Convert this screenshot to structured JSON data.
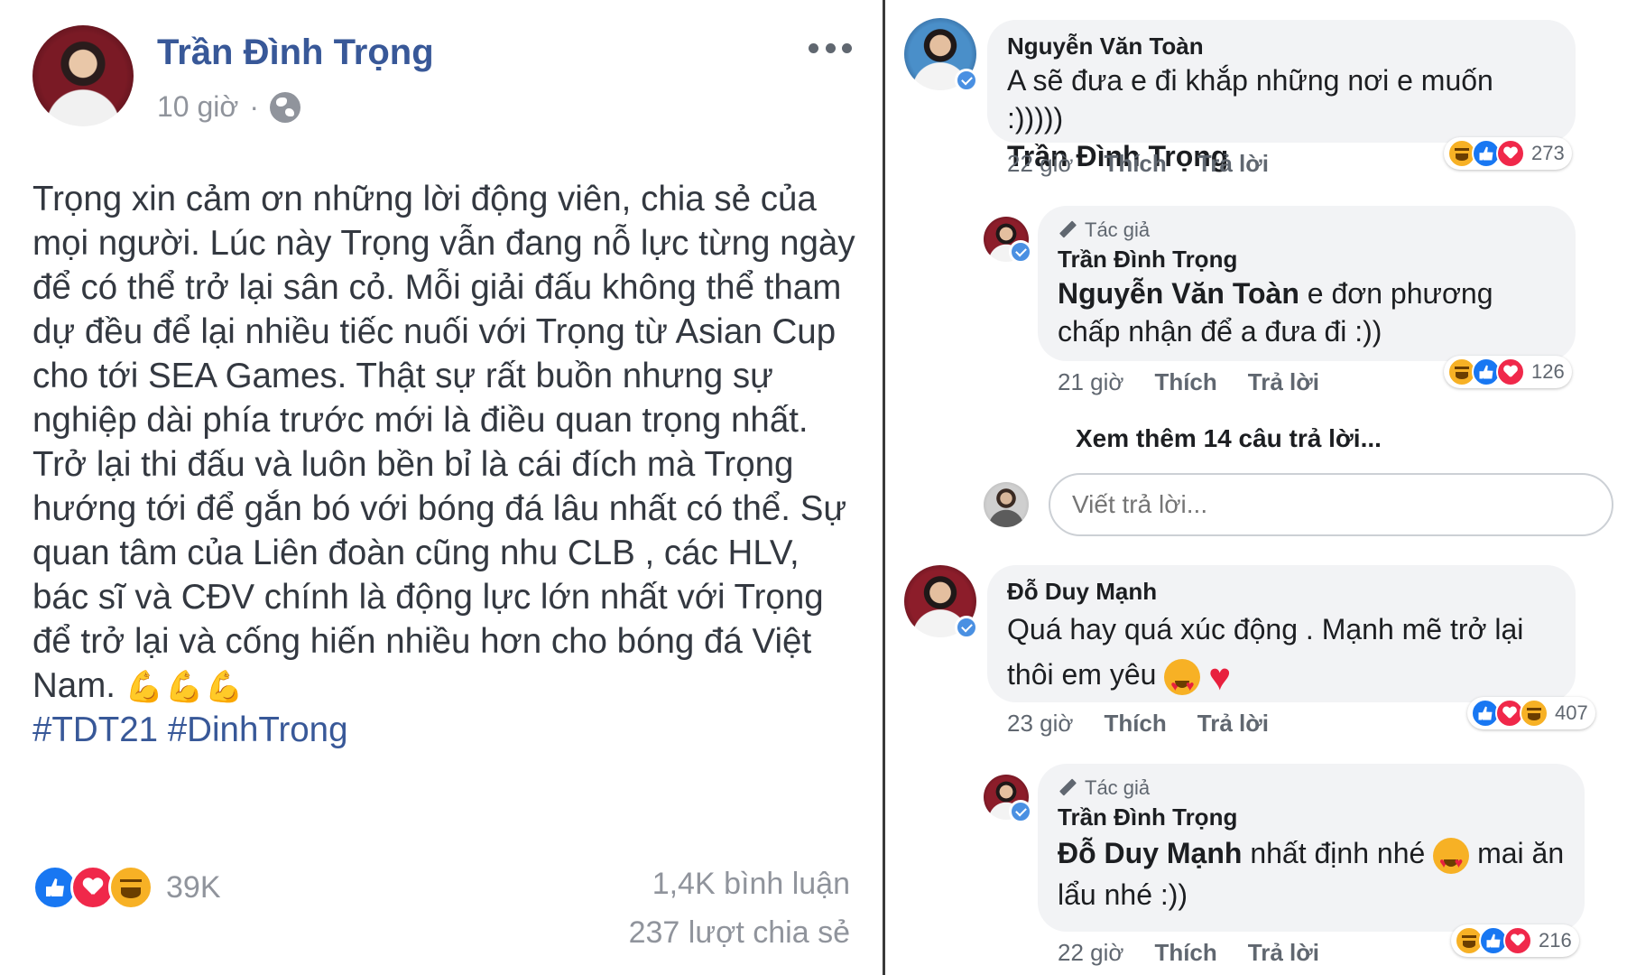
{
  "post": {
    "author": "Trần Đình Trọng",
    "time": "10 giờ",
    "time_separator": "·",
    "body": "Trọng xin cảm ơn những lời động viên, chia sẻ của mọi người. Lúc này Trọng vẫn đang nỗ lực từng ngày để có thể trở lại sân cỏ. Mỗi giải đấu không thể tham dự đều để lại nhiều tiếc nuối với Trọng từ Asian Cup cho tới SEA Games. Thật sự rất buồn nhưng sự nghiệp dài phía trước mới là điều quan trọng nhất. Trở lại thi đấu và luôn bền bỉ là cái đích mà Trọng hướng tới để gắn bó với bóng đá lâu nhất có thể. Sự quan tâm của Liên đoàn cũng nhu CLB , các HLV, bác sĩ và CĐV chính là động lực lớn nhất với Trọng để trở lại và cống hiến nhiều hơn cho bóng đá Việt Nam.",
    "emoji": "💪💪💪",
    "hashtags": "#TDT21 #DinhTrong",
    "reaction_count": "39K",
    "comment_count": "1,4K bình luận",
    "share_count": "237 lượt chia sẻ",
    "reaction_icons": [
      "like-icon",
      "love-icon",
      "haha-icon"
    ]
  },
  "comments": [
    {
      "name": "Nguyễn Văn Toàn",
      "text": "A sẽ đưa e đi khắp những nơi e muốn :)))))",
      "mention": "Trần Đình Trọng",
      "time": "22 giờ",
      "like": "Thích",
      "reply": "Trả lời",
      "reaction_count": "273",
      "reaction_icons": [
        "haha-icon",
        "like-icon",
        "love-icon"
      ]
    },
    {
      "author_tag": "Tác giả",
      "name": "Trần Đình Trọng",
      "mention": "Nguyễn Văn Toàn",
      "text": " e đơn phương chấp nhận để a đưa đi :))",
      "time": "21 giờ",
      "like": "Thích",
      "reply": "Trả lời",
      "reaction_count": "126",
      "reaction_icons": [
        "haha-icon",
        "like-icon",
        "love-icon"
      ]
    },
    {
      "name": "Đỗ Duy Mạnh",
      "text": "Quá hay quá xúc động . Mạnh mẽ trở lại thôi em yêu",
      "time": "23 giờ",
      "like": "Thích",
      "reply": "Trả lời",
      "reaction_count": "407",
      "reaction_icons": [
        "like-icon",
        "love-icon",
        "haha-icon"
      ]
    },
    {
      "author_tag": "Tác giả",
      "name": "Trần Đình Trọng",
      "mention": "Đỗ Duy Mạnh",
      "text_a": " nhất định nhé ",
      "text_b": " mai ăn lẩu nhé :))",
      "time": "22 giờ",
      "like": "Thích",
      "reply": "Trả lời",
      "reaction_count": "216",
      "reaction_icons": [
        "haha-icon",
        "like-icon",
        "love-icon"
      ]
    }
  ],
  "see_more_replies": "Xem thêm 14 câu trả lời...",
  "reply_input": {
    "placeholder": "Viết trả lời..."
  },
  "colors": {
    "link_blue": "#385898",
    "like_blue": "#1877f2",
    "love_red": "#f0284a",
    "haha_yellow": "#f7b125",
    "bubble_gray": "#f2f3f5",
    "meta_gray": "#90949c"
  }
}
